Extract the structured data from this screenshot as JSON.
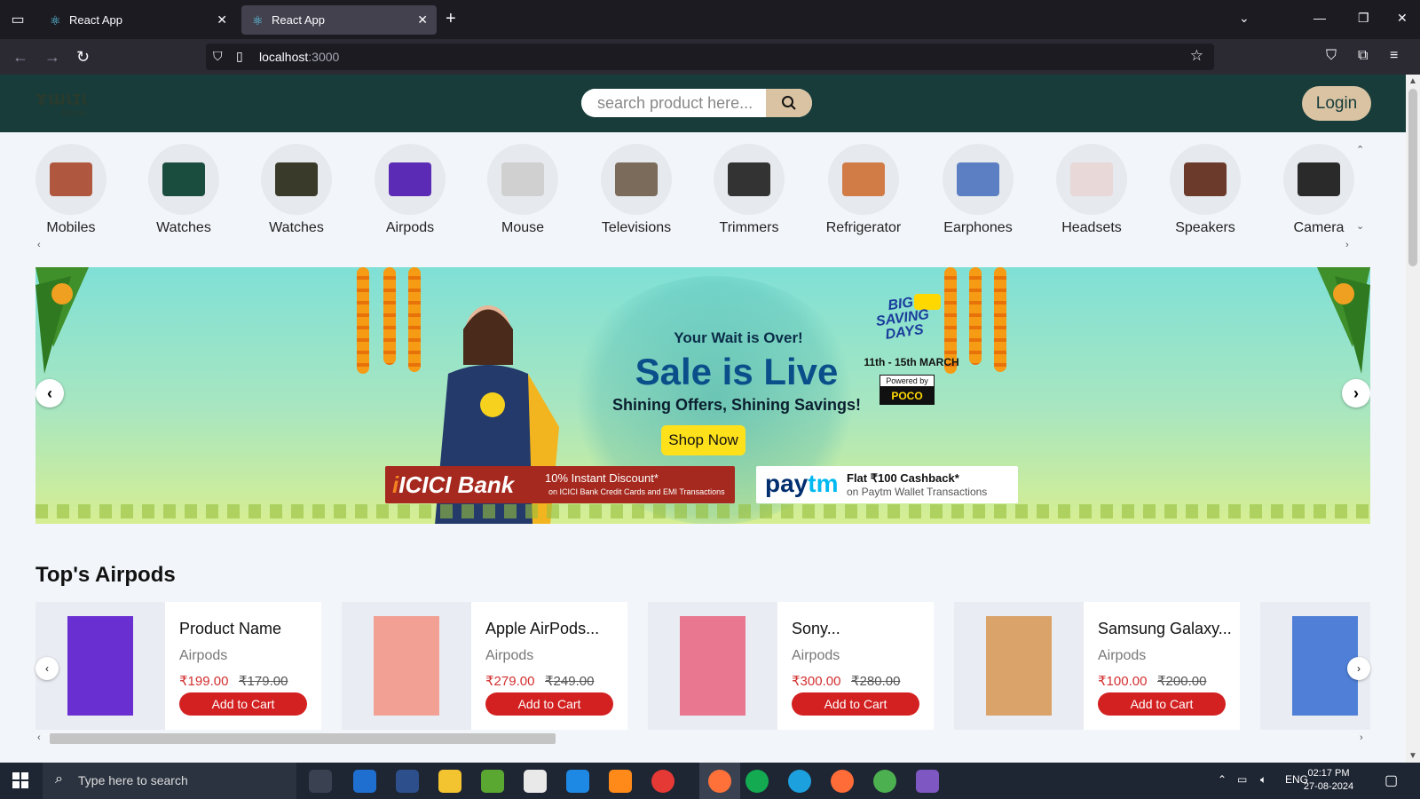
{
  "browser": {
    "tabs": [
      {
        "title": "React App",
        "active": false
      },
      {
        "title": "React App",
        "active": true
      }
    ],
    "url_host": "localhost",
    "url_port": ":3000"
  },
  "header": {
    "logo": "ɤɯɩɪɩ",
    "logo_sub": "Neonic",
    "search_placeholder": "search product here...",
    "login_label": "Login"
  },
  "categories": [
    {
      "label": "Mobiles",
      "color": "#b0583f"
    },
    {
      "label": "Watches",
      "color": "#1b4d3e"
    },
    {
      "label": "Watches",
      "color": "#3a3a2a"
    },
    {
      "label": "Airpods",
      "color": "#5b2bb5"
    },
    {
      "label": "Mouse",
      "color": "#d0d0d0"
    },
    {
      "label": "Televisions",
      "color": "#7a6b5a"
    },
    {
      "label": "Trimmers",
      "color": "#333333"
    },
    {
      "label": "Refrigerator",
      "color": "#d17b47"
    },
    {
      "label": "Earphones",
      "color": "#5b7fc2"
    },
    {
      "label": "Headsets",
      "color": "#e8d8d8"
    },
    {
      "label": "Speakers",
      "color": "#6b3a2a"
    },
    {
      "label": "Camera",
      "color": "#2a2a2a"
    }
  ],
  "banner": {
    "wait": "Your Wait is Over!",
    "sale": "Sale is Live",
    "shining": "Shining Offers, Shining Savings!",
    "shop_now": "Shop Now",
    "big_saving": "BIG SAVING DAYS",
    "dates": "11th - 15th MARCH",
    "powered_by": "Powered by",
    "poco": "POCO",
    "icici_logo": "ICICI Bank",
    "icici_offer": "10% Instant Discount*",
    "icici_sub": "on ICICI Bank Credit Cards and EMI Transactions",
    "paytm_logo_a": "pay",
    "paytm_logo_b": "tm",
    "paytm_offer": "Flat ₹100 Cashback*",
    "paytm_sub": "on Paytm Wallet Transactions"
  },
  "section": {
    "title": "Top's Airpods"
  },
  "products": [
    {
      "name": "Product Name",
      "category": "Airpods",
      "price": "₹199.00",
      "old_price": "₹179.00",
      "cart": "Add to Cart",
      "color": "#6a2fd1"
    },
    {
      "name": "Apple AirPods...",
      "category": "Airpods",
      "price": "₹279.00",
      "old_price": "₹249.00",
      "cart": "Add to Cart",
      "color": "#f2a093"
    },
    {
      "name": "Sony...",
      "category": "Airpods",
      "price": "₹300.00",
      "old_price": "₹280.00",
      "cart": "Add to Cart",
      "color": "#e97790"
    },
    {
      "name": "Samsung Galaxy...",
      "category": "Airpods",
      "price": "₹100.00",
      "old_price": "₹200.00",
      "cart": "Add to Cart",
      "color": "#d9a36a"
    },
    {
      "name": "",
      "category": "",
      "price": "",
      "old_price": "",
      "cart": "",
      "color": "#4f7fd6"
    }
  ],
  "taskbar": {
    "search_placeholder": "Type here to search",
    "lang": "ENG",
    "time": "02:17 PM",
    "date": "27-08-2024"
  }
}
